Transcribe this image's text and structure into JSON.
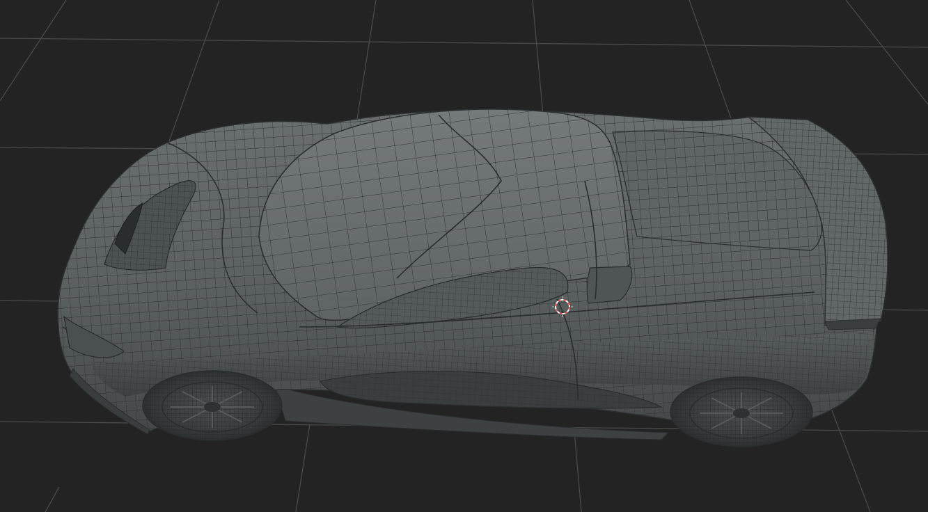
{
  "viewport": {
    "background_color": "#232323",
    "grid_color": "#4a4a4a",
    "view_mode": "wireframe-on-shaded",
    "model_color": "#5c6161",
    "model_edge_color": "#2c2f30",
    "cursor_color_a": "#e35555",
    "cursor_color_b": "#ffffff"
  },
  "icons": {
    "cursor": "3d-cursor-icon"
  }
}
